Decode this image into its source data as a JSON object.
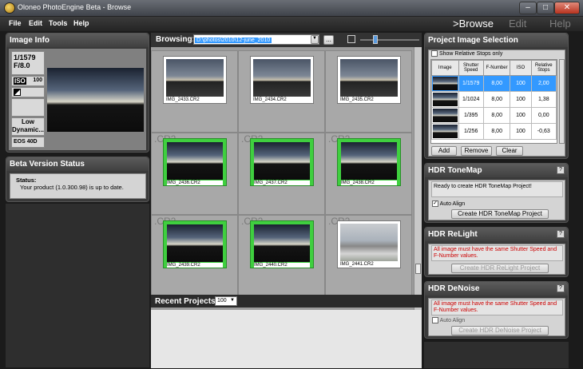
{
  "window": {
    "title": "Oloneo PhotoEngine Beta - Browse"
  },
  "menu": [
    {
      "label": "File"
    },
    {
      "label": "Edit"
    },
    {
      "label": "Tools"
    },
    {
      "label": "Help"
    }
  ],
  "nav": {
    "browse": ">Browse",
    "edit": "Edit",
    "help": "Help"
  },
  "image_info": {
    "title": "Image Info",
    "shutter": "1/1579",
    "aperture": "F/8.0",
    "iso_label": "ISO",
    "iso_value": "100",
    "dynamic": "Low Dynamic...",
    "camera": "EOS 40D"
  },
  "beta_status": {
    "title": "Beta Version Status",
    "status_label": "Status:",
    "status_text": "Your product (1.0.300.98) is up to date."
  },
  "browsing": {
    "label": "Browsing:",
    "path": "D:\\photos\\2010\\12-june_2010",
    "browse_btn": "...",
    "cells": [
      {
        "ext": "",
        "name": "IMG_2433.CR2",
        "selected": false,
        "look": "a"
      },
      {
        "ext": "",
        "name": "IMG_2434.CR2",
        "selected": false,
        "look": "a"
      },
      {
        "ext": "",
        "name": "IMG_2435.CR2",
        "selected": false,
        "look": "a"
      },
      {
        "ext": ".CR2",
        "name": "IMG_2436.CR2",
        "selected": true,
        "look": "b"
      },
      {
        "ext": ".CR2",
        "name": "IMG_2437.CR2",
        "selected": true,
        "look": "b"
      },
      {
        "ext": ".CR2",
        "name": "IMG_2438.CR2",
        "selected": true,
        "look": "b"
      },
      {
        "ext": ".CR2",
        "name": "IMG_2439.CR2",
        "selected": true,
        "look": "b"
      },
      {
        "ext": ".CR2",
        "name": "IMG_2440.CR2",
        "selected": true,
        "look": "b"
      },
      {
        "ext": ".CR2",
        "name": "IMG_2441.CR2",
        "selected": false,
        "look": "c"
      }
    ]
  },
  "recent_projects": {
    "label": "Recent Projects:",
    "count": "100"
  },
  "project_selection": {
    "title": "Project Image Selection",
    "relative_label": "Show Relative Stops only",
    "columns": [
      "Image",
      "Shutter Speed",
      "F-Number",
      "ISO",
      "Relative Stops"
    ],
    "rows": [
      {
        "shutter": "1/1579",
        "fnum": "8,00",
        "iso": "100",
        "stops": "2,00"
      },
      {
        "shutter": "1/1024",
        "fnum": "8,00",
        "iso": "100",
        "stops": "1,38"
      },
      {
        "shutter": "1/395",
        "fnum": "8,00",
        "iso": "100",
        "stops": "0,00"
      },
      {
        "shutter": "1/256",
        "fnum": "8,00",
        "iso": "100",
        "stops": "-0,63"
      }
    ],
    "add": "Add",
    "remove": "Remove",
    "clear": "Clear"
  },
  "tonemap": {
    "title": "HDR ToneMap",
    "message": "Ready to create HDR ToneMap Project!",
    "auto_align": "Auto Align",
    "button": "Create HDR ToneMap Project"
  },
  "relight": {
    "title": "HDR ReLight",
    "message": "All image must have the same Shutter Speed and F-Number values.",
    "button": "Create HDR ReLight Project"
  },
  "denoise": {
    "title": "HDR DeNoise",
    "message": "All image must have the same Shutter Speed and F-Number values.",
    "auto_align": "Auto Align",
    "button": "Create HDR DeNoise Project"
  },
  "help_icon": "?",
  "colors": {
    "selected_row": "#3399ff",
    "selection_frame": "#3fcf3f",
    "error_text": "#cc0000"
  }
}
